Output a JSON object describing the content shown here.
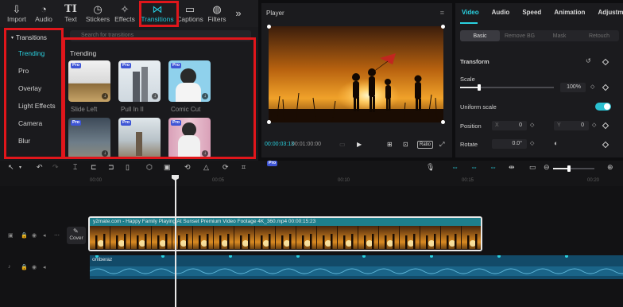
{
  "toolbar": {
    "items": [
      {
        "label": "Import",
        "icon": "import-icon"
      },
      {
        "label": "Audio",
        "icon": "audio-icon"
      },
      {
        "label": "Text",
        "icon": "text-icon"
      },
      {
        "label": "Stickers",
        "icon": "stickers-icon"
      },
      {
        "label": "Effects",
        "icon": "effects-icon"
      },
      {
        "label": "Transitions",
        "icon": "transitions-icon"
      },
      {
        "label": "Captions",
        "icon": "captions-icon"
      },
      {
        "label": "Filters",
        "icon": "filters-icon"
      }
    ],
    "more_icon": "chevron-double-right-icon"
  },
  "left_panel": {
    "category_header": "Transitions",
    "categories": [
      "Trending",
      "Pro",
      "Overlay",
      "Light Effects",
      "Camera",
      "Blur"
    ],
    "search_placeholder": "Search for transitions",
    "section_title": "Trending",
    "cards": [
      {
        "label": "Slide Left",
        "pro": "Pro"
      },
      {
        "label": "Pull In II",
        "pro": "Pro"
      },
      {
        "label": "Comic Cut",
        "pro": "Pro"
      },
      {
        "label": "",
        "pro": "Pro"
      },
      {
        "label": "",
        "pro": "Pro"
      },
      {
        "label": "",
        "pro": "Pro"
      }
    ]
  },
  "player": {
    "title": "Player",
    "current_time": "00:00:03:13",
    "total_time": "00:01:00:00",
    "ratio_label": "Ratio"
  },
  "inspector": {
    "tabs": [
      "Video",
      "Audio",
      "Speed",
      "Animation",
      "Adjustment"
    ],
    "subtabs": [
      "Basic",
      "Remove BG",
      "Mask",
      "Retouch"
    ],
    "transform_label": "Transform",
    "scale_label": "Scale",
    "scale_value": "100%",
    "uniform_scale_label": "Uniform scale",
    "position_label": "Position",
    "position_x_prefix": "X",
    "position_x": "0",
    "position_y_prefix": "Y",
    "position_y": "0",
    "rotate_label": "Rotate",
    "rotate_value": "0.0°"
  },
  "timeline": {
    "ruler_ticks": [
      "00:00",
      "00:05",
      "00:10",
      "00:15",
      "00:20"
    ],
    "video_clip_label": "y2mate.com - Happy Family Playing At Sunset  Premium Video Footage  4K_360.mp4  00:00:15:23",
    "audio_clip_label": "omberaz",
    "cover_label": "Cover"
  },
  "colors": {
    "accent": "#2ad1e0",
    "highlight_box": "#e0161b",
    "pro_badge": "#3f56d6"
  }
}
